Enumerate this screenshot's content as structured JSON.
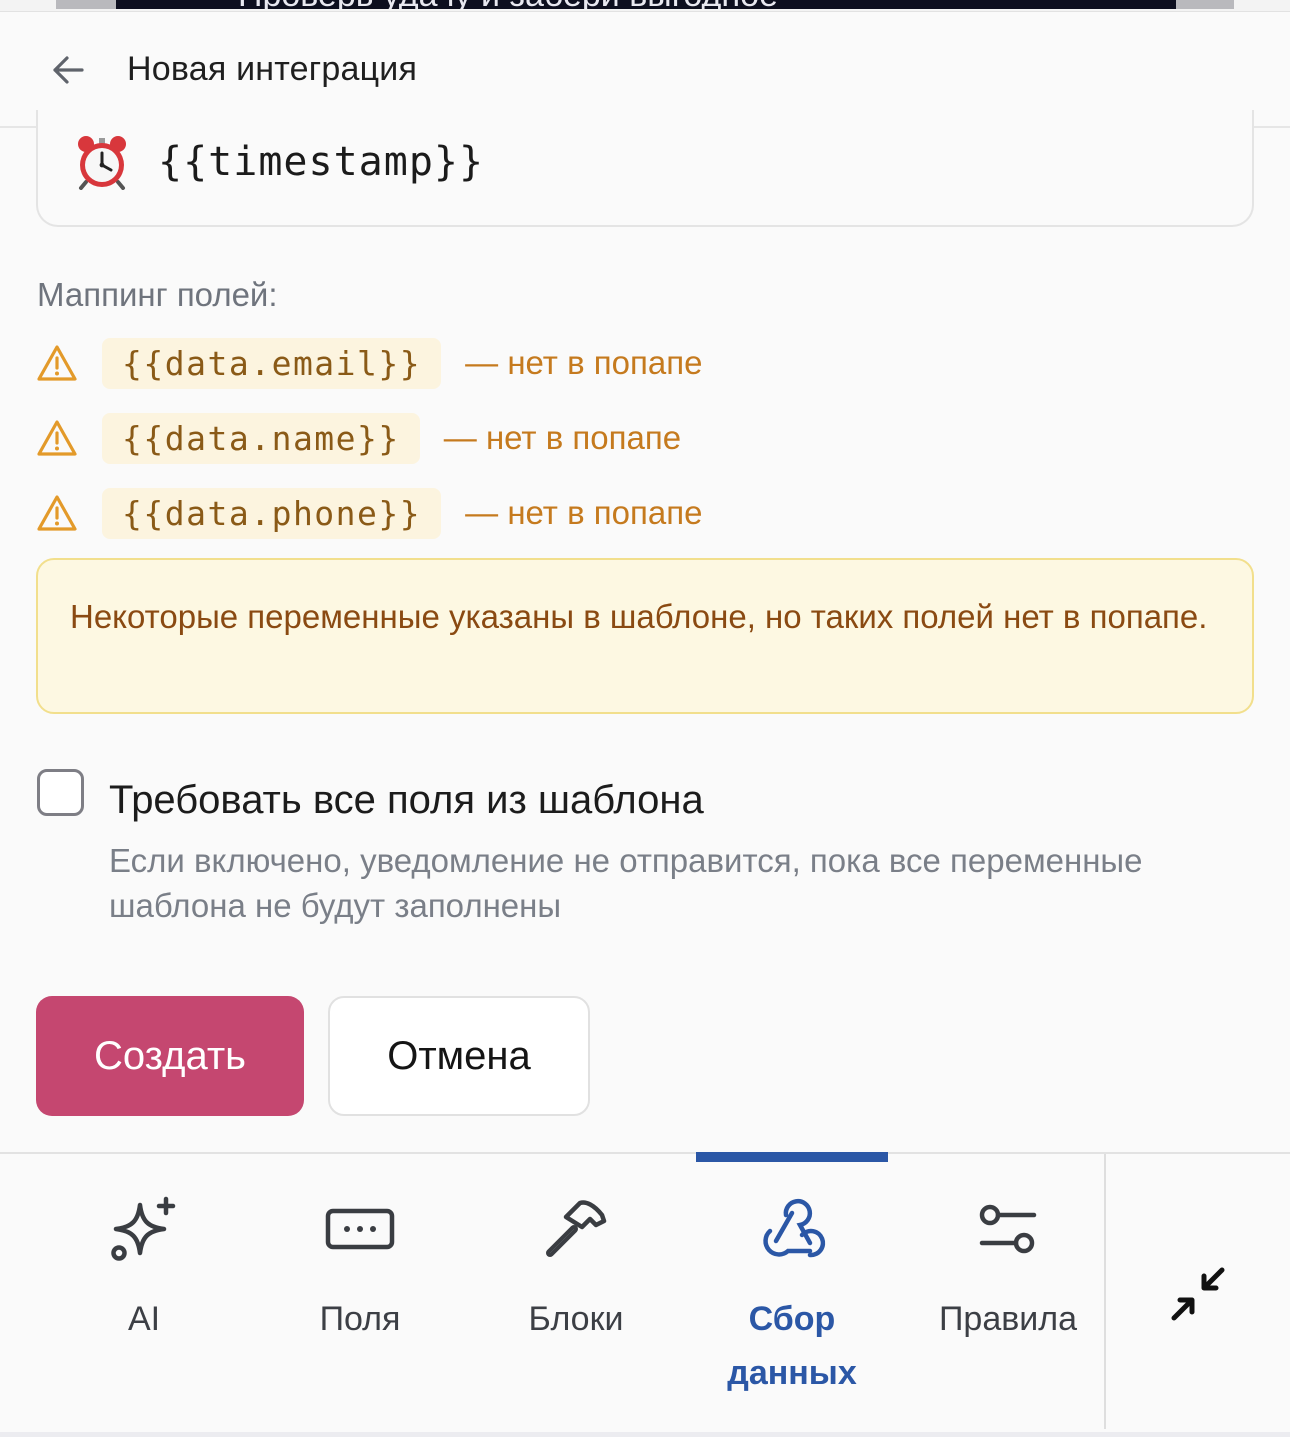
{
  "top_banner": {
    "text": "Проверь удачу и забери выгодное"
  },
  "header": {
    "title": "Новая интеграция"
  },
  "timestamp_card": {
    "emoji": "⏰",
    "value": "{{timestamp}}"
  },
  "mapping": {
    "label": "Маппинг полей:",
    "rows": [
      {
        "variable": "{{data.email}}",
        "note": "— нет в попапе"
      },
      {
        "variable": "{{data.name}}",
        "note": "— нет в попапе"
      },
      {
        "variable": "{{data.phone}}",
        "note": "— нет в попапе"
      }
    ]
  },
  "alert": {
    "text": "Некоторые переменные указаны в шаблоне, но таких полей нет в попапе."
  },
  "require_all": {
    "checked": false,
    "label": "Требовать все поля из шаблона",
    "description": "Если включено, уведомление не отправится, пока все переменные шаблона не будут заполнены"
  },
  "actions": {
    "create_label": "Создать",
    "cancel_label": "Отмена"
  },
  "tabs": [
    {
      "label": "AI",
      "icon": "sparkle-icon",
      "active": false
    },
    {
      "label": "Поля",
      "icon": "input-field-icon",
      "active": false
    },
    {
      "label": "Блоки",
      "icon": "hammer-icon",
      "active": false
    },
    {
      "label": "Сбор данных",
      "icon": "webhook-icon",
      "active": true
    },
    {
      "label": "Правила",
      "icon": "sliders-icon",
      "active": false
    }
  ],
  "colors": {
    "primary": "#c54770",
    "active_tab": "#2b57a6",
    "warning": "#e39a2a",
    "alert_bg": "#fdf8e2"
  }
}
